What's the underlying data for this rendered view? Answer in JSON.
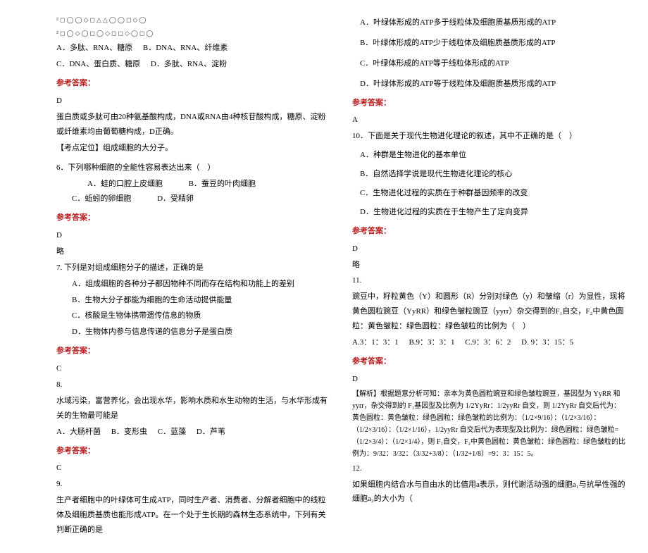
{
  "left": {
    "shapes_line1": "²◻◯◯◇◻△△◯◯◻◇◯",
    "shapes_line2": "²◻◯◇◯◻◯◇◻◻◇◯◻◯",
    "q5": {
      "optA": "A．多肽、RNA、糖原",
      "optB": "B．DNA、RNA、纤维素",
      "optC": "C．DNA、蛋白质、糖原",
      "optD": "D．多肽、RNA、淀粉",
      "ans_header": "参考答案：",
      "ans_letter": "D",
      "expl1": "蛋白质或多肽可由20种氨基酸构成，DNA或RNA由4种核苷酸构成，糖原、淀粉或纤维素均由葡萄糖构成，D正确。",
      "point": "【考点定位】组成细胞的大分子。"
    },
    "q6": {
      "stem": "6．下列哪种细胞的全能性容易表达出来（　）",
      "optA": "A．蛙的口腔上皮细胞",
      "optB": "B．蚕豆的叶肉细胞",
      "optC": "C．蚯蚓的卵细胞",
      "optD": "D．受精卵",
      "ans_header": "参考答案：",
      "ans_letter": "D",
      "brief": "略"
    },
    "q7": {
      "stem": "7. 下列是对组成细胞分子的描述，正确的是",
      "optA": "A．组成细胞的各种分子都因物种不同而存在结构和功能上的差别",
      "optB": "B．生物大分子都能为细胞的生命活动提供能量",
      "optC": "C．核酸是生物体携带遗传信息的物质",
      "optD": "D．生物体内参与信息传递的信息分子是蛋白质",
      "ans_header": "参考答案：",
      "ans_letter": "C"
    },
    "q8": {
      "num": "8.",
      "stem": "水域污染，富营养化，会出现水华，影响水质和水生动物的生活，与水华形成有关的生物最可能是",
      "optA": "A．大肠杆菌",
      "optB": "B．变形虫",
      "optC": "C．蓝藻",
      "optD": "D．芦苇",
      "ans_header": "参考答案：",
      "ans_letter": "C"
    },
    "q9": {
      "num": "9.",
      "stem": "生产者细胞中的叶绿体可生成ATP，同时生产者、消费者、分解者细胞中的线粒体及细胞质基质也能形成ATP。在一个处于生长期的森林生态系统中，下列有关判断正确的是"
    }
  },
  "right": {
    "q9opts": {
      "optA": "A．叶绿体形成的ATP多于线粒体及细胞质基质形成的ATP",
      "optB": "B．叶绿体形成的ATP少于线粒体及细胞质基质形成的ATP",
      "optC": "C．叶绿体形成的ATP等于线粒体形成的ATP",
      "optD": "D．叶绿体形成的ATP等于线粒体及细胞质基质形成的ATP",
      "ans_header": "参考答案：",
      "ans_letter": "A"
    },
    "q10": {
      "stem": "10．下面是关于现代生物进化理论的叙述，其中不正确的是（　）",
      "optA": "A．种群是生物进化的基本单位",
      "optB": "B．自然选择学说是现代生物进化理论的核心",
      "optC": "C．生物进化过程的实质在于种群基因频率的改变",
      "optD": "D．生物进化过程的实质在于生物产生了定向变异",
      "ans_header": "参考答案：",
      "ans_letter": "D",
      "brief": "略"
    },
    "q11": {
      "num": "11.",
      "stem1": "豌豆中，籽粒黄色（Y）和圆形（R）分别对绿色（y）和皱缩（r）为显性，现将黄色圆粒豌豆（YyRR）和绿色皱粒豌豆（yyrr）杂交得到的F₁自交，F₂中黄色圆粒：黄色皱粒：绿色圆粒：绿色皱粒的比例为（　）",
      "optA": "A.3：1：3：1",
      "optB": "B.9：3：3：1",
      "optC": "C.9：3：6：2",
      "optD": "D. 9：3：15：5",
      "ans_header": "参考答案：",
      "ans_letter": "D",
      "expl": "【解析】根据题意分析可知：亲本为黄色圆粒豌豆和绿色皱粒豌豆，基因型为 YyRR 和 yyrr，杂交得到的 F₁基因型及比例为 1/2YyRr：1/2yyRr 自交，则 1/2YyRr 自交后代为：黄色圆粒：黄色皱粒：绿色圆粒：绿色皱粒的比例为：（1/2×9/16）：（1/2×3/16）：（1/2×3/16）：（1/2×1/16），1/2yyRr 自交后代为表现型及比例为：绿色圆粒：绿色皱粒=（1/2×3/4）：（1/2×1/4），则 F₁自交，F₂中黄色圆粒：黄色皱粒：绿色圆粒：绿色皱粒的比例为：9/32：3/32：（3/32+3/8）：（1/32+1/8）=9：3：15：5。"
    },
    "q12": {
      "num": "12.",
      "stem": "如果细胞内结合水与自由水的比值用a表示，则代谢活动强的细胞a₁与抗旱性强的细胞a₂的大小为（"
    }
  }
}
